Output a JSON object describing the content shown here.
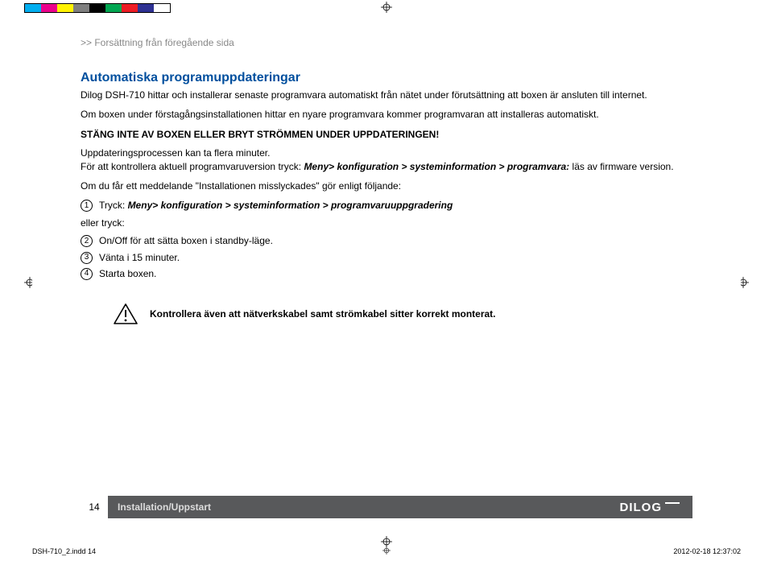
{
  "colorbar": [
    "#00aeef",
    "#ec008c",
    "#fff200",
    "#7f7f7f",
    "#000000",
    "#00a651",
    "#ed1c24",
    "#2e3192",
    "#ffffff"
  ],
  "crumb": ">> Forsättning från föregående sida",
  "heading": "Automatiska programuppdateringar",
  "para1": "Dilog DSH-710 hittar och installerar senaste programvara automatiskt från nätet under förutsättning att boxen är ansluten till internet.",
  "para2": "Om boxen under förstagångsinstallationen hittar en nyare programvara kommer programvaran att installeras automatiskt.",
  "warn": "STÄNG INTE AV BOXEN ELLER BRYT STRÖMMEN UNDER UPPDATERINGEN!",
  "para3a": "Uppdateringsprocessen kan ta flera minuter.",
  "para3b_pre": "För att kontrollera aktuell programvaruversion tryck: ",
  "para3b_em": "Meny> konfiguration > systeminformation > programvara:",
  "para3b_post": " läs av firmware version.",
  "para4": " Om du får ett meddelande \"Installationen misslyckades\" gör enligt följande:",
  "steps_a": [
    {
      "n": "1",
      "pre": "Tryck: ",
      "em": "Meny> konfiguration > systeminformation > programvaruuppgradering"
    }
  ],
  "ellertryck": "eller tryck:",
  "steps_b": [
    {
      "n": "2",
      "text": "On/Off för att sätta boxen i standby-läge."
    },
    {
      "n": "3",
      "text": "Vänta i 15 minuter."
    },
    {
      "n": "4",
      "text": "Starta boxen."
    }
  ],
  "notice": "Kontrollera även att nätverkskabel samt strömkabel sitter korrekt monterat.",
  "footer": {
    "page": "14",
    "section": "Installation/Uppstart",
    "logo": "DILOG"
  },
  "printline": {
    "file": "DSH-710_2.indd   14",
    "timestamp": "2012-02-18   12:37:02"
  }
}
